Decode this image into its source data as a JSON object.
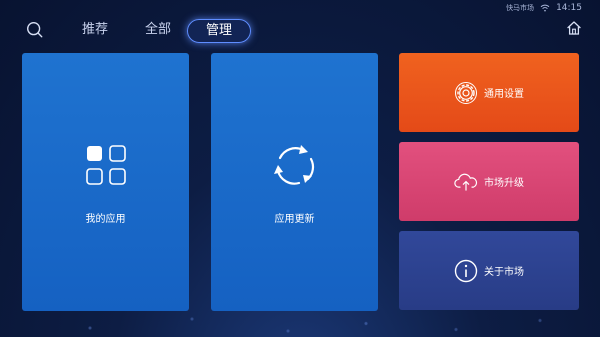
{
  "status_bar": {
    "store_name": "快马市场",
    "time": "14:15"
  },
  "nav": {
    "tabs": [
      {
        "label": "推荐"
      },
      {
        "label": "全部"
      },
      {
        "label": "管理",
        "selected": true
      }
    ]
  },
  "tiles": {
    "my_apps": "我的应用",
    "app_update": "应用更新",
    "general_settings": "通用设置",
    "market_upgrade": "市场升级",
    "about_market": "关于市场"
  },
  "icons": {
    "search": "search-icon",
    "home": "home-icon",
    "wifi": "wifi-icon",
    "my_apps": "app-grid-icon",
    "app_update": "refresh-icon",
    "general_settings": "gear-icon",
    "market_upgrade": "cloud-upload-icon",
    "about_market": "info-icon"
  },
  "colors": {
    "background": "#0b1a3f",
    "tile_blue": "#1a69c9",
    "tile_orange": "#ea561b",
    "tile_pink": "#d94674",
    "tile_indigo": "#2d4290",
    "tab_highlight": "#5f8dff"
  }
}
